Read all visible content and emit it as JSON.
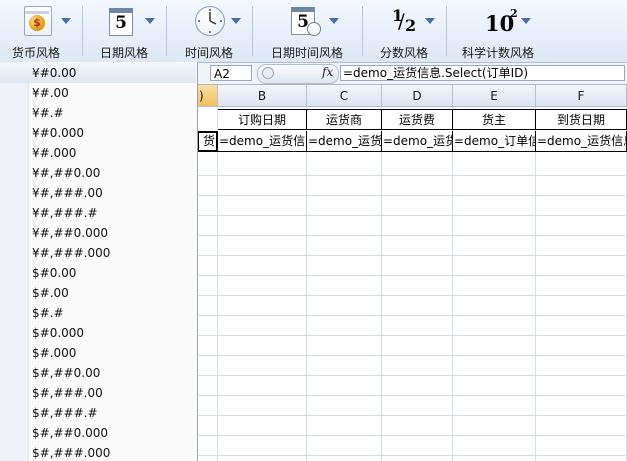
{
  "ribbon": {
    "groups": [
      {
        "key": "currency",
        "label": "货币风格"
      },
      {
        "key": "date",
        "label": "日期风格",
        "icon_text": "5"
      },
      {
        "key": "time",
        "label": "时间风格"
      },
      {
        "key": "datetime",
        "label": "日期时间风格",
        "icon_text": "5"
      },
      {
        "key": "fraction",
        "label": "分数风格",
        "num": "1",
        "den": "2"
      },
      {
        "key": "scientific",
        "label": "科学计数风格",
        "base": "10",
        "exp": "2"
      }
    ],
    "currency_symbol": "$"
  },
  "formula_bar": {
    "name_box": "A2",
    "fx": "fx",
    "formula": "=demo_运货信息.Select(订单ID)"
  },
  "grid": {
    "columns": [
      "",
      "B",
      "C",
      "D",
      "E",
      "F"
    ],
    "header_row": [
      "订购日期",
      "运货商",
      "运货费",
      "货主",
      "到货日期"
    ],
    "formula_row": [
      "货",
      "=demo_运货信息",
      "=demo_运货信",
      "=demo_运货信",
      "=demo_订单信息",
      "=demo_运货信息"
    ],
    "partial_a_header": ")"
  },
  "dropdown": {
    "items": [
      "¥#0.00",
      "¥#.00",
      "¥#.#",
      "¥#0.000",
      "¥#.000",
      "¥#,##0.00",
      "¥#,###.00",
      "¥#,###.#",
      "¥#,##0.000",
      "¥#,###.000",
      "$#0.00",
      "$#.00",
      "$#.#",
      "$#0.000",
      "$#.000",
      "$#,##0.00",
      "$#,###.00",
      "$#,###.#",
      "$#,##0.000",
      "$#,###.000"
    ]
  },
  "colors": {
    "selected_header": "#f2bf5e",
    "ribbon_bg": "#dde8f6",
    "arrow": "#4a6e9a"
  }
}
